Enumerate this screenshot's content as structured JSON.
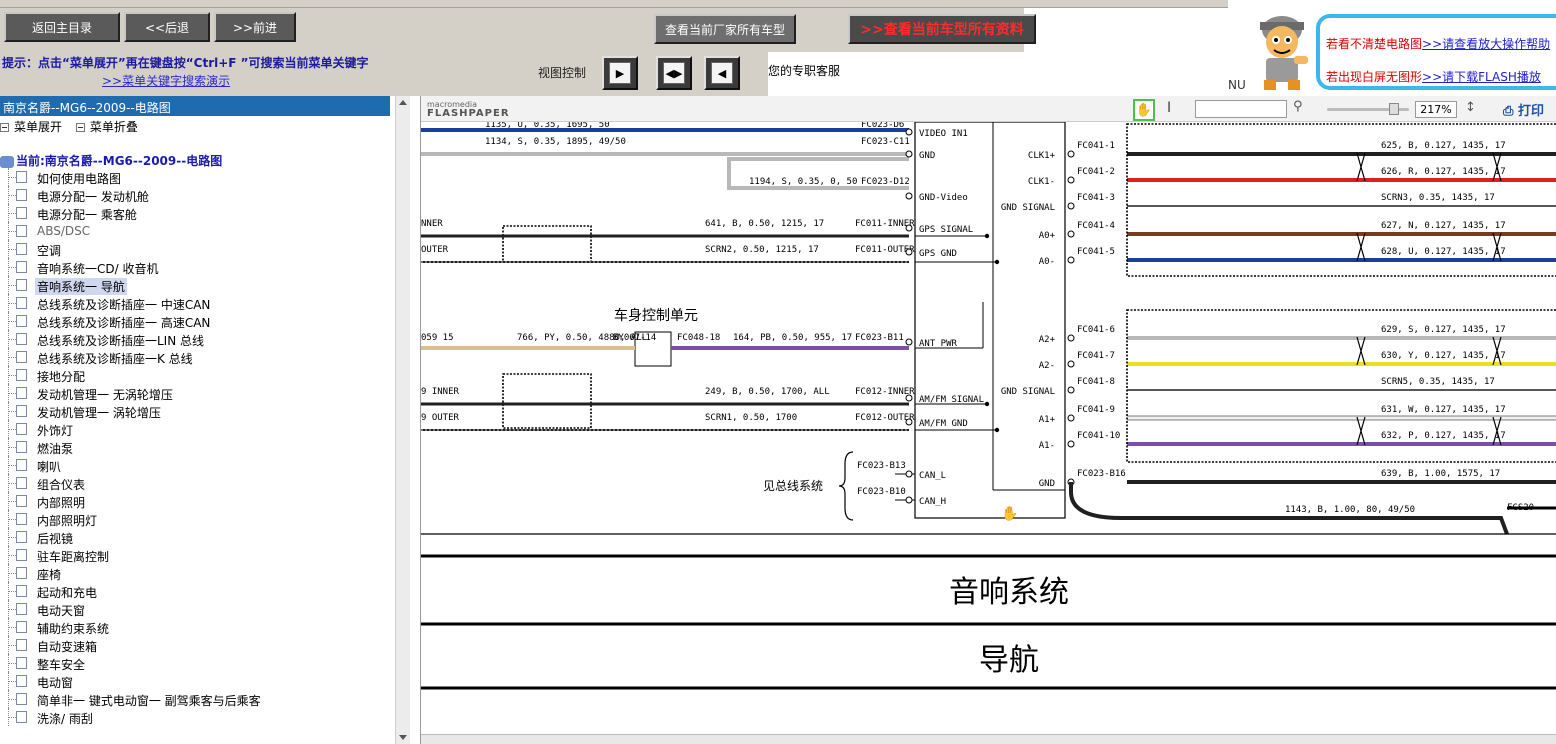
{
  "toolbar": {
    "back_main": "返回主目录",
    "back": "<<后退",
    "forward": ">>前进",
    "view_factory_models": "查看当前厂家所有车型",
    "view_model_all": ">>查看当前车型所有资料"
  },
  "hint": {
    "line1": "提示：点击“菜单展开”再在键盘按“Ctrl+F ”可搜索当前菜单关键字",
    "line2": ">>菜单关键字搜索演示",
    "view_control": "视图控制",
    "service": "您的专职客服"
  },
  "promo": {
    "line1_text": "若看不清楚电路图",
    "line1_link": ">>请查看放大操作帮助",
    "line2_text": "若出现白屏无图形",
    "line2_link": ">>请下载FLASH播放",
    "nu": "NU"
  },
  "tree": {
    "title": "南京名爵--MG6--2009--电路图",
    "expand": "菜单展开",
    "collapse": "菜单折叠",
    "root": "当前:南京名爵--MG6--2009--电路图",
    "items": [
      "如何使用电路图",
      "电源分配一 发动机舱",
      "电源分配一 乘客舱",
      "ABS/DSC",
      "空调",
      "音响系统一CD/ 收音机",
      "音响系统一 导航",
      "总线系统及诊断插座一 中速CAN",
      "总线系统及诊断插座一 高速CAN",
      "总线系统及诊断插座一LIN 总线",
      "总线系统及诊断插座一K 总线",
      "接地分配",
      "发动机管理一 无涡轮增压",
      "发动机管理一 涡轮增压",
      "外饰灯",
      "燃油泵",
      "喇叭",
      "组合仪表",
      "内部照明",
      "内部照明灯",
      "后视镜",
      "驻车距离控制",
      "座椅",
      "起动和充电",
      "电动天窗",
      "辅助约束系统",
      "自动变速箱",
      "整车安全",
      "电动窗",
      "简单非一 键式电动窗一 副驾乘客与后乘客",
      "洗涤/ 雨刮"
    ]
  },
  "flashpaper": {
    "brand_top": "macromedia",
    "brand": "FLASHPAPER",
    "zoom": "217%",
    "print": "打印"
  },
  "diagram": {
    "title1": "音响系统",
    "title2": "导航",
    "body_unit": "车身控制单元",
    "bus_ref": "见总线系统",
    "left_wires": [
      "1135, U, 0.35, 1695, 50",
      "1134, S, 0.35, 1895, 49/50",
      "1194, S, 0.35, 0, 50",
      "641, B, 0.50, 1215, 17",
      "SCRN2, 0.50, 1215, 17",
      "766, PY, 0.50, 4880, ALL",
      "164, PB, 0.50, 955, 17",
      "249, B, 0.50, 1700, ALL",
      "SCRN1, 0.50, 1700"
    ],
    "left_stubs": [
      "NNER",
      "OUTER",
      "059 15",
      "9 INNER",
      "9 OUTER"
    ],
    "left_conns": [
      "BY067-14",
      "FC048-18"
    ],
    "connectors_mid": [
      "FC023-D6",
      "FC023-C11",
      "FC023-D12",
      "FC011-INNER",
      "FC011-OUTER",
      "FC023-B11",
      "FC012-INNER",
      "FC012-OUTER",
      "FC023-B13",
      "FC023-B10"
    ],
    "pins_left": [
      "VIDEO IN1",
      "GND",
      "GND-Video",
      "GPS SIGNAL",
      "GPS GND",
      "ANT_PWR",
      "AM/FM SIGNAL",
      "AM/FM GND",
      "CAN_L",
      "CAN_H"
    ],
    "pins_right": [
      "CLK1+",
      "CLK1-",
      "GND SIGNAL",
      "A0+",
      "A0-",
      "A2+",
      "A2-",
      "GND SIGNAL",
      "A1+",
      "A1-",
      "GND"
    ],
    "right_conns": [
      "FC041-1",
      "FC041-2",
      "FC041-3",
      "FC041-4",
      "FC041-5",
      "FC041-6",
      "FC041-7",
      "FC041-8",
      "FC041-9",
      "FC041-10",
      "FC023-B16"
    ],
    "right_wires": [
      "625, B, 0.127, 1435, 17",
      "626, R, 0.127, 1435, 17",
      "SCRN3, 0.35, 1435, 17",
      "627, N, 0.127, 1435, 17",
      "628, U, 0.127, 1435, 17",
      "629, S, 0.127, 1435, 17",
      "630, Y, 0.127, 1435, 17",
      "SCRN5, 0.35, 1435, 17",
      "631, W, 0.127, 1435, 17",
      "632, P, 0.127, 1435, 17",
      "639, B, 1.00, 1575, 17",
      "1143, B, 1.00, 80, 49/50"
    ],
    "ground": "FCS20"
  },
  "colors": {
    "wire_black": "#202020",
    "wire_red": "#e02020",
    "wire_brown": "#7a3a20",
    "wire_blue": "#1a3f9a",
    "wire_gray": "#b8b8b8",
    "wire_yellow": "#e8e020",
    "wire_purple": "#7a50a8",
    "wire_tan": "#d8c090",
    "tree_header": "#1f6bb0",
    "promo_border": "#3cb8e8"
  }
}
